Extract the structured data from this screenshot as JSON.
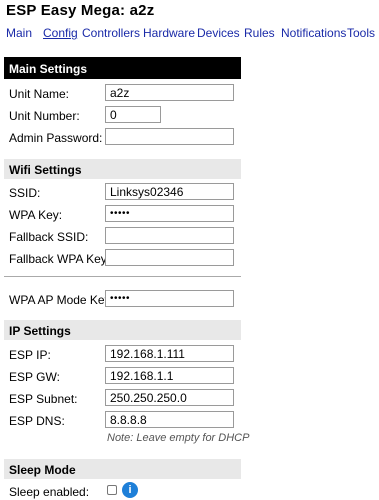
{
  "header": {
    "title": "ESP Easy Mega: a2z"
  },
  "nav": {
    "items": [
      {
        "label": "Main"
      },
      {
        "label": "Config"
      },
      {
        "label": "Controllers"
      },
      {
        "label": "Hardware"
      },
      {
        "label": "Devices"
      },
      {
        "label": "Rules"
      },
      {
        "label": "Notifications"
      },
      {
        "label": "Tools"
      }
    ],
    "active": "Config"
  },
  "main_settings": {
    "title": "Main Settings",
    "unit_name": {
      "label": "Unit Name:",
      "value": "a2z"
    },
    "unit_number": {
      "label": "Unit Number:",
      "value": "0"
    },
    "admin_password": {
      "label": "Admin Password:",
      "value": ""
    }
  },
  "wifi_settings": {
    "title": "Wifi Settings",
    "ssid": {
      "label": "SSID:",
      "value": "Linksys02346"
    },
    "wpa_key": {
      "label": "WPA Key:",
      "value": "•••••"
    },
    "fallback_ssid": {
      "label": "Fallback SSID:",
      "value": ""
    },
    "fallback_wpa_key": {
      "label": "Fallback WPA Key:",
      "value": ""
    },
    "wpa_ap_mode_key": {
      "label": "WPA AP Mode Key:",
      "value": "•••••"
    }
  },
  "ip_settings": {
    "title": "IP Settings",
    "esp_ip": {
      "label": "ESP IP:",
      "value": "192.168.1.111"
    },
    "esp_gw": {
      "label": "ESP GW:",
      "value": "192.168.1.1"
    },
    "esp_subnet": {
      "label": "ESP Subnet:",
      "value": "250.250.250.0"
    },
    "esp_dns": {
      "label": "ESP DNS:",
      "value": "8.8.8.8"
    },
    "note": "Note: Leave empty for DHCP"
  },
  "sleep_mode": {
    "title": "Sleep Mode",
    "sleep_enabled": {
      "label": "Sleep enabled:",
      "checked": false
    },
    "help_icon_glyph": "i"
  }
}
